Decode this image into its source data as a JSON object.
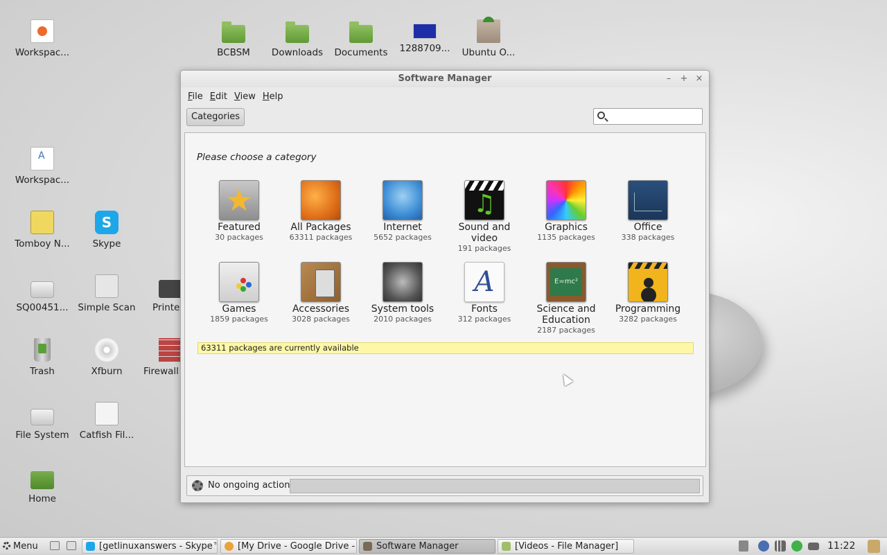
{
  "desktop": {
    "icons": [
      {
        "label": "Workspac...",
        "icon": "presentation-file-icon"
      },
      {
        "label": "BCBSM",
        "icon": "folder-icon"
      },
      {
        "label": "Downloads",
        "icon": "folder-icon"
      },
      {
        "label": "Documents",
        "icon": "folder-icon"
      },
      {
        "label": "1288709...",
        "icon": "image-file-icon"
      },
      {
        "label": "Ubuntu O...",
        "icon": "package-box-icon"
      },
      {
        "label": "Workspac...",
        "icon": "text-document-icon"
      },
      {
        "label": "Tomboy N...",
        "icon": "tomboy-notes-icon"
      },
      {
        "label": "Skype",
        "icon": "skype-icon"
      },
      {
        "label": "SQ00451...",
        "icon": "drive-icon"
      },
      {
        "label": "Simple Scan",
        "icon": "scanner-icon"
      },
      {
        "label": "Printe",
        "icon": "printer-icon"
      },
      {
        "label": "Trash",
        "icon": "trash-icon"
      },
      {
        "label": "Xfburn",
        "icon": "disc-icon"
      },
      {
        "label": "Firewall",
        "icon": "firewall-icon"
      },
      {
        "label": "File System",
        "icon": "drive-icon"
      },
      {
        "label": "Catfish Fil...",
        "icon": "catfish-search-icon"
      },
      {
        "label": "Home",
        "icon": "home-folder-icon"
      }
    ]
  },
  "window": {
    "title": "Software Manager",
    "controls": {
      "minimize": "–",
      "maximize": "+",
      "close": "×"
    },
    "menu": [
      "File",
      "Edit",
      "View",
      "Help"
    ],
    "categories_button": "Categories",
    "search": {
      "value": "",
      "placeholder": ""
    },
    "prompt": "Please choose a category",
    "categories": [
      {
        "name": "Featured",
        "count": "30 packages",
        "icon": "star-icon"
      },
      {
        "name": "All Packages",
        "count": "63311 packages",
        "icon": "gears-icon"
      },
      {
        "name": "Internet",
        "count": "5652 packages",
        "icon": "globe-icon"
      },
      {
        "name": "Sound and video",
        "count": "191 packages",
        "icon": "clapperboard-music-icon"
      },
      {
        "name": "Graphics",
        "count": "1135 packages",
        "icon": "color-wheel-icon"
      },
      {
        "name": "Office",
        "count": "338 packages",
        "icon": "line-chart-icon"
      },
      {
        "name": "Games",
        "count": "1859 packages",
        "icon": "gamepad-icon"
      },
      {
        "name": "Accessories",
        "count": "3028 packages",
        "icon": "calculator-icon"
      },
      {
        "name": "System tools",
        "count": "2010 packages",
        "icon": "system-gears-icon"
      },
      {
        "name": "Fonts",
        "count": "312 packages",
        "icon": "font-icon"
      },
      {
        "name": "Science and Education",
        "count": "2187 packages",
        "icon": "chalkboard-icon"
      },
      {
        "name": "Programming",
        "count": "3282 packages",
        "icon": "construction-icon"
      }
    ],
    "availability": "63311 packages are currently available",
    "actions_status": "No ongoing actions"
  },
  "taskbar": {
    "menu_label": "Menu",
    "tasks": [
      {
        "label": "[getlinuxanswers - Skype™]",
        "icon": "skype-icon",
        "color": "#1ea7e8"
      },
      {
        "label": "[My Drive - Google Drive - ...",
        "icon": "chrome-icon",
        "color": "#e8a33a"
      },
      {
        "label": "Software Manager",
        "icon": "software-manager-icon",
        "color": "#7a6a55"
      },
      {
        "label": "[Videos - File Manager]",
        "icon": "file-manager-icon",
        "color": "#9fbd6a"
      }
    ],
    "clock": "11:22"
  }
}
